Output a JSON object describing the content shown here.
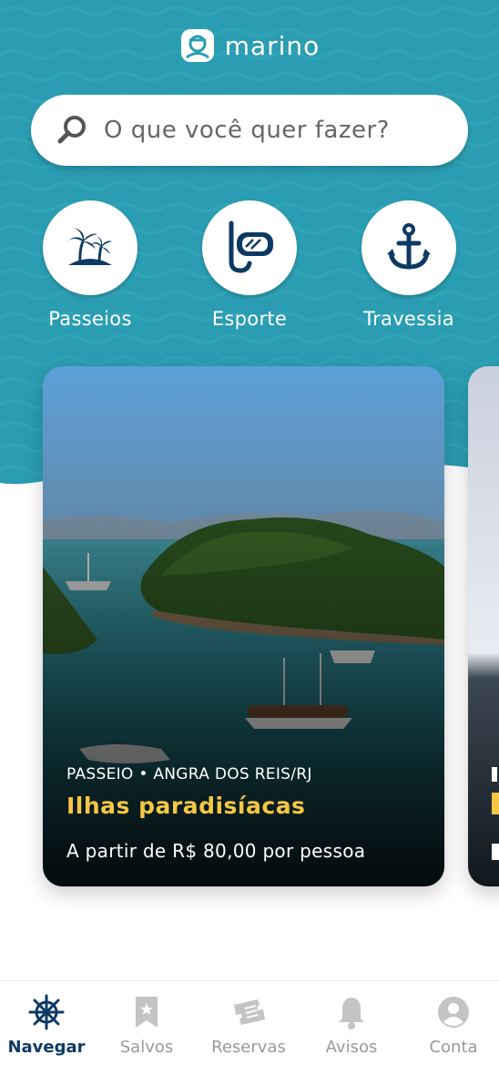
{
  "app": {
    "logo_text": "marino"
  },
  "search": {
    "placeholder": "O que você quer fazer?"
  },
  "categories": [
    {
      "label": "Passeios",
      "icon": "palm-island-icon"
    },
    {
      "label": "Esporte",
      "icon": "snorkel-mask-icon"
    },
    {
      "label": "Travessia",
      "icon": "anchor-icon"
    }
  ],
  "cards": [
    {
      "kicker": "PASSEIO • ANGRA DOS REIS/RJ",
      "title": "Ilhas paradisíacas",
      "price": "A partir de R$ 80,00 por pessoa"
    }
  ],
  "tabbar": {
    "items": [
      {
        "label": "Navegar",
        "icon": "helm-icon",
        "active": true
      },
      {
        "label": "Salvos",
        "icon": "bookmark-icon",
        "active": false
      },
      {
        "label": "Reservas",
        "icon": "ticket-icon",
        "active": false
      },
      {
        "label": "Avisos",
        "icon": "bell-icon",
        "active": false
      },
      {
        "label": "Conta",
        "icon": "user-icon",
        "active": false
      }
    ]
  },
  "colors": {
    "primary": "#2b9fb3",
    "navy": "#0d3a63",
    "accent_title": "#f6c744",
    "inactive": "#b8b8b8"
  }
}
